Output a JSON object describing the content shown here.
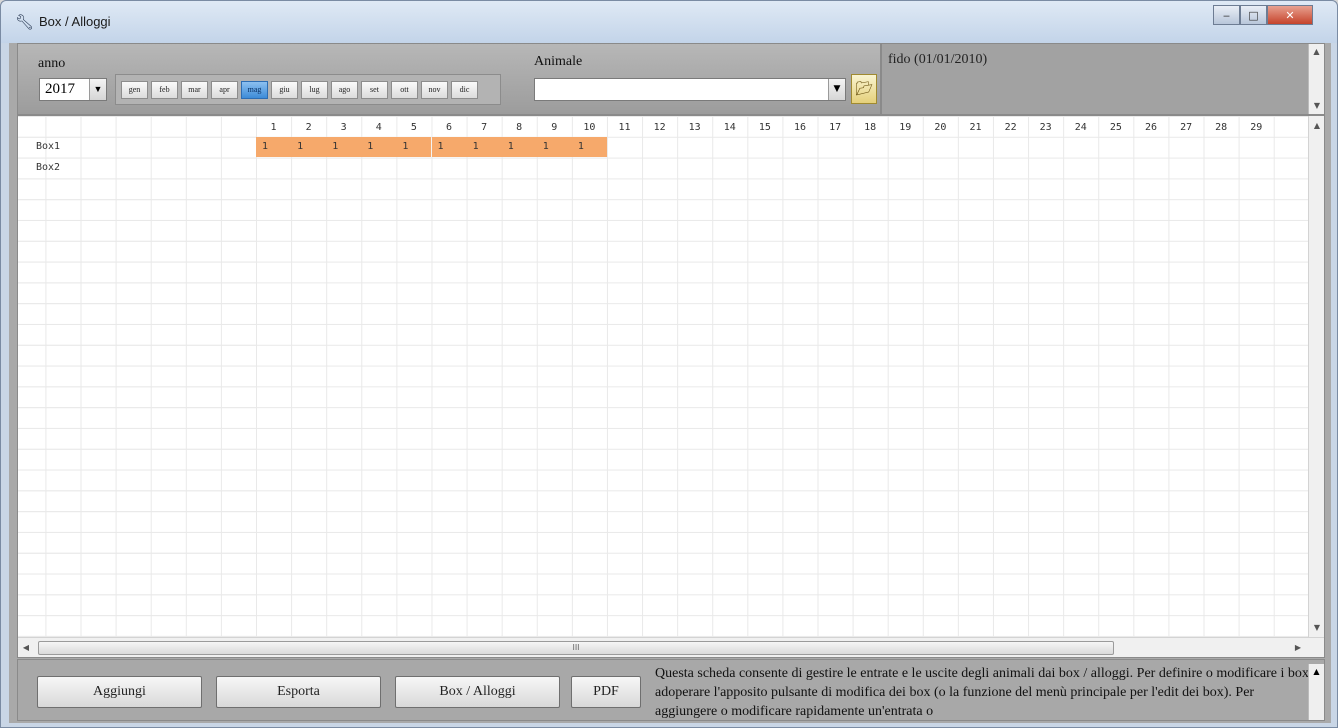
{
  "window": {
    "title": "Box / Alloggi",
    "icon": "wrench-icon"
  },
  "filters": {
    "year_label": "anno",
    "year_value": "2017",
    "months": [
      "gen",
      "feb",
      "mar",
      "apr",
      "mag",
      "giu",
      "lug",
      "ago",
      "set",
      "ott",
      "nov",
      "dic"
    ],
    "selected_month": "mag",
    "animal_label": "Animale",
    "animal_value": ""
  },
  "info": {
    "text": "fido (01/01/2010)"
  },
  "grid": {
    "days": [
      "1",
      "2",
      "3",
      "4",
      "5",
      "6",
      "7",
      "8",
      "9",
      "10",
      "11",
      "12",
      "13",
      "14",
      "15",
      "16",
      "17",
      "18",
      "19",
      "20",
      "21",
      "22",
      "23",
      "24",
      "25",
      "26",
      "27",
      "28",
      "29"
    ],
    "rows": [
      {
        "label": "Box1",
        "cells": [
          "1",
          "1",
          "1",
          "1",
          "1",
          "1",
          "1",
          "1",
          "1",
          "1"
        ]
      },
      {
        "label": "Box2",
        "cells": []
      }
    ],
    "occupied_color": "#f6a96b",
    "hscroll_thumb": "III"
  },
  "buttons": {
    "add": "Aggiungi",
    "export": "Esporta",
    "boxes": "Box / Alloggi",
    "pdf": "PDF"
  },
  "help": {
    "text": "Questa scheda consente di gestire le entrate e le uscite degli animali dai box / alloggi. Per definire o modificare i box, adoperare l'apposito pulsante di modifica dei box (o la funzione del menù principale per l'edit dei box). Per aggiungere o modificare rapidamente un'entrata o"
  }
}
